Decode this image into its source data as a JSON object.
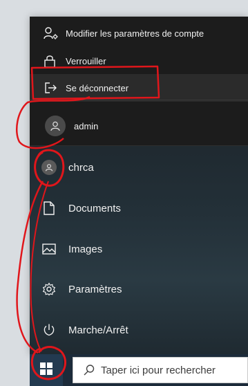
{
  "account_menu": {
    "items": [
      {
        "label": "Modifier les paramètres de compte",
        "icon": "account-settings-icon"
      },
      {
        "label": "Verrouiller",
        "icon": "lock-icon"
      },
      {
        "label": "Se déconnecter",
        "icon": "sign-out-icon"
      }
    ],
    "other_user": {
      "name": "admin",
      "icon": "user-avatar-icon"
    }
  },
  "start_menu": {
    "current_user": "chrca",
    "items": [
      {
        "label": "Documents",
        "icon": "document-icon"
      },
      {
        "label": "Images",
        "icon": "image-icon"
      },
      {
        "label": "Paramètres",
        "icon": "gear-icon"
      },
      {
        "label": "Marche/Arrêt",
        "icon": "power-icon"
      }
    ]
  },
  "taskbar": {
    "search_placeholder": "Taper ici pour rechercher",
    "start_icon": "windows-logo-icon",
    "search_icon": "search-icon"
  },
  "colors": {
    "annotation": "#e0161b",
    "flyout_bg": "#1c1c1c",
    "menu_text": "#f1f1f1",
    "taskbar_bg": "#1c2b3a"
  }
}
